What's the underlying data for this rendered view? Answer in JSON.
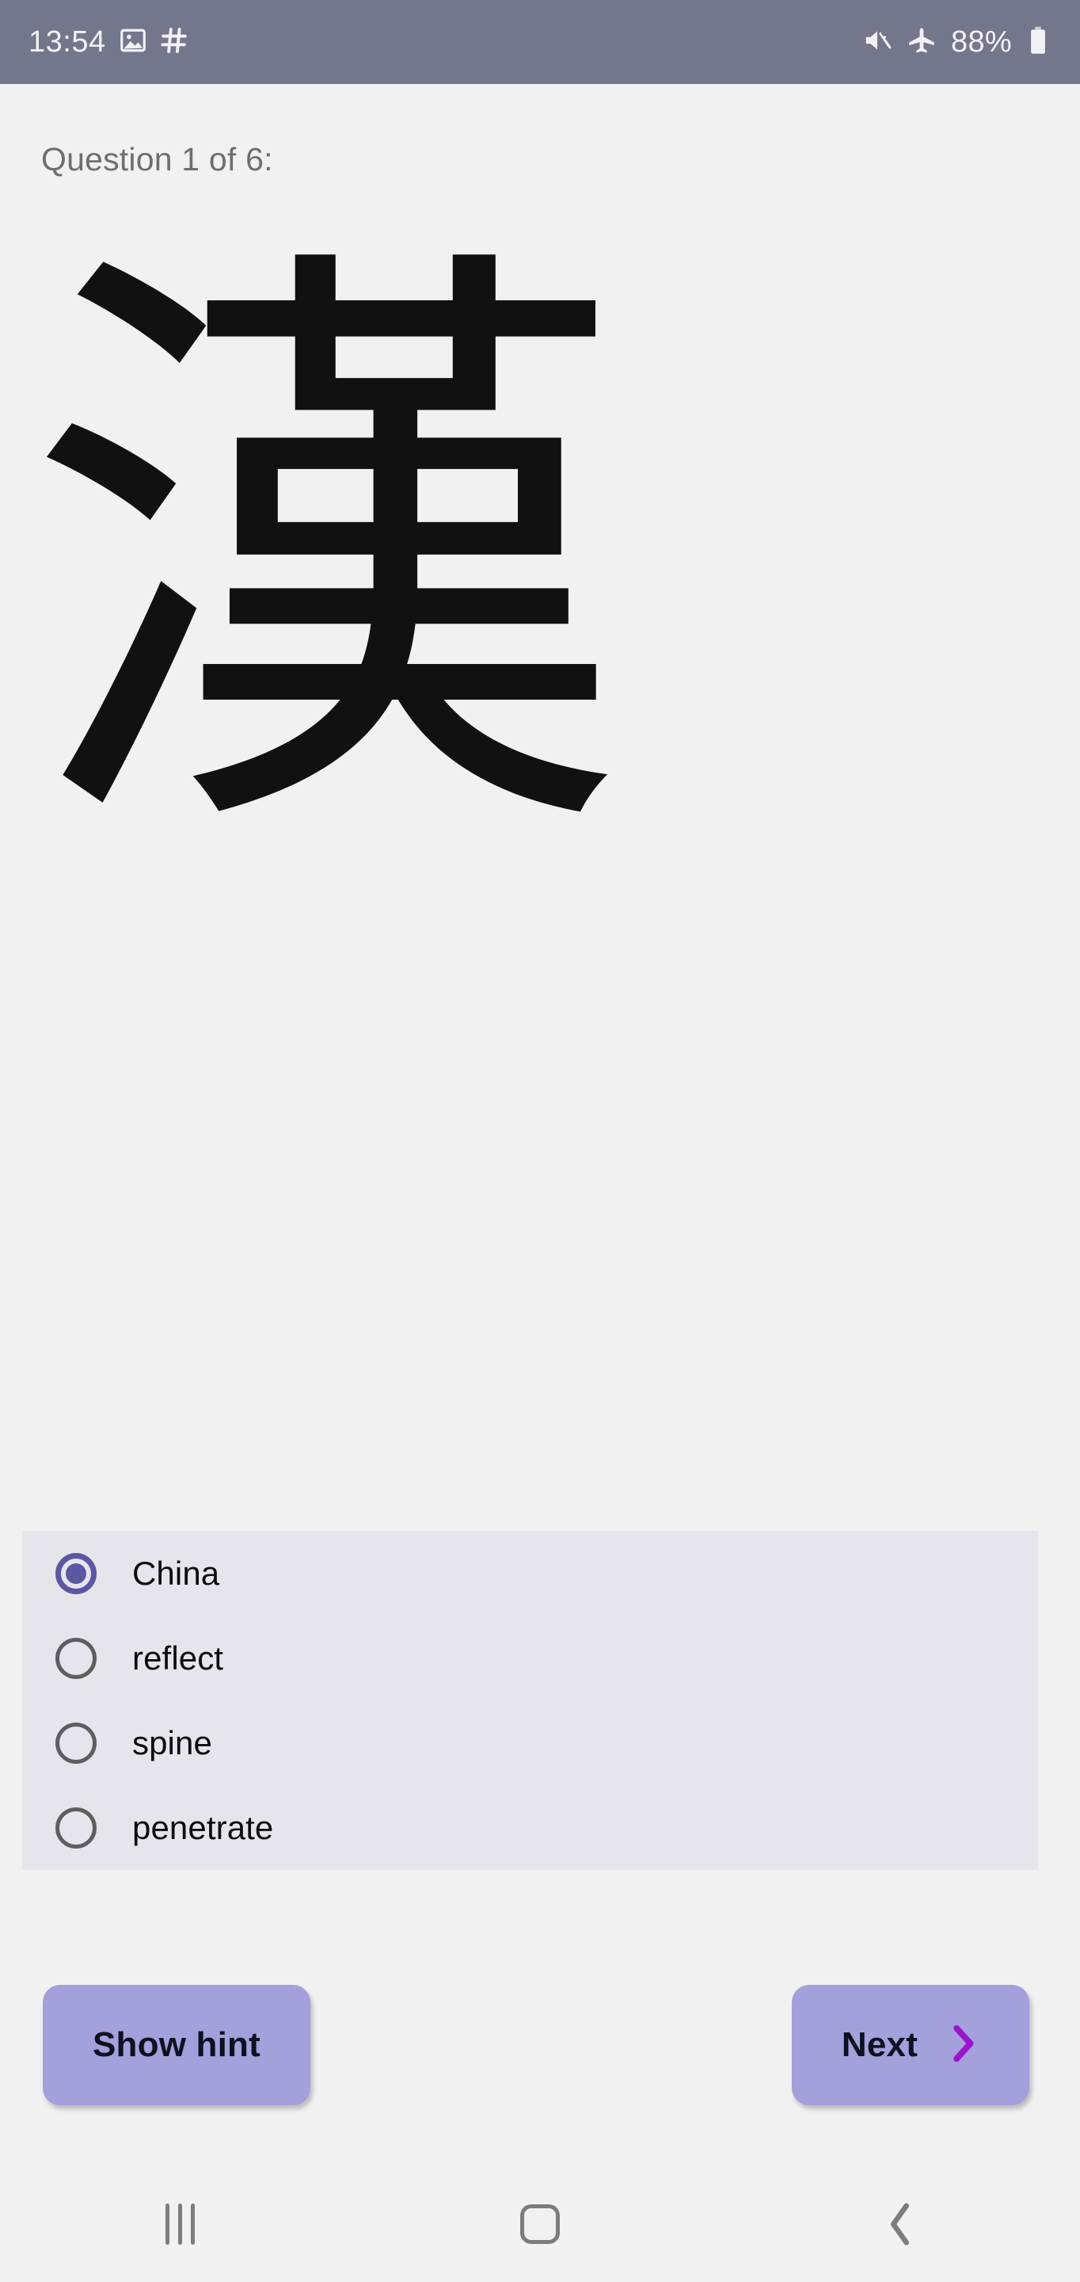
{
  "status_bar": {
    "time": "13:54",
    "battery_percent": "88%",
    "left_icons": [
      "gallery-icon",
      "hash-icon"
    ],
    "right_icons": [
      "mute-icon",
      "airplane-mode-icon",
      "battery-icon"
    ],
    "background_color": "#74768c",
    "text_color": "#f2f2f5"
  },
  "quiz": {
    "progress_label": "Question 1 of 6:",
    "prompt_character": "漢",
    "current_question": 1,
    "total_questions": 6,
    "options": [
      {
        "label": "China",
        "selected": true
      },
      {
        "label": "reflect",
        "selected": false
      },
      {
        "label": "spine",
        "selected": false
      },
      {
        "label": "penetrate",
        "selected": false
      }
    ],
    "selected_option": "China",
    "panel_color": "#e6e5eb",
    "accent_color": "#5b57a3"
  },
  "actions": {
    "hint_label": "Show hint",
    "next_label": "Next",
    "next_icon": "chevron-right-icon",
    "button_color": "#a3a0dc",
    "next_icon_color": "#9c12cd"
  },
  "nav_bar": {
    "recents": "recents-icon",
    "home": "home-icon",
    "back": "back-icon",
    "icon_color": "#7d7d7d"
  },
  "page": {
    "background_color": "#f1f1f1"
  }
}
